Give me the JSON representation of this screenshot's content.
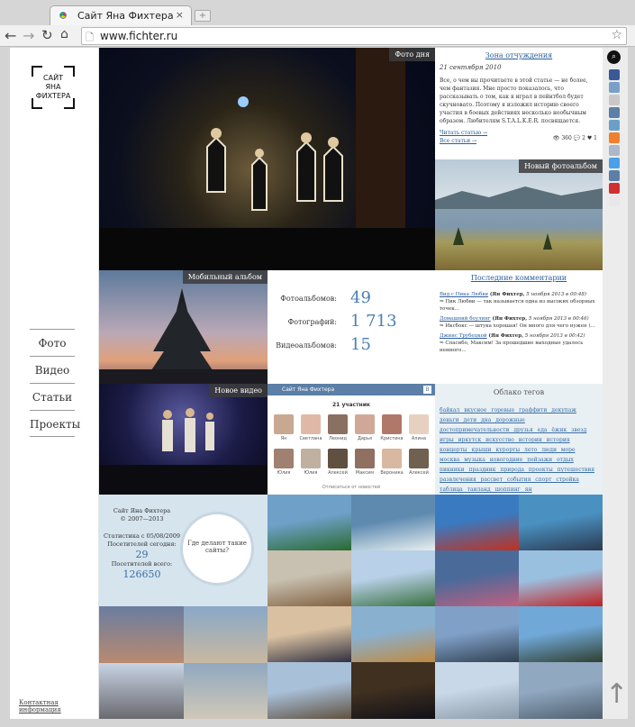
{
  "browser": {
    "tab_title": "Сайт Яна Фихтера",
    "tab_close": "×",
    "new_tab": "+",
    "url": "www.fichter.ru",
    "icons": [
      "back-icon",
      "forward-icon",
      "reload-icon",
      "home-icon",
      "page-icon",
      "star-icon"
    ]
  },
  "sidebar": {
    "logo": [
      "САЙТ",
      "ЯНА",
      "ФИХТЕРА"
    ],
    "menu": [
      "Фото",
      "Видео",
      "Статьи",
      "Проекты"
    ],
    "contact": "Контактная информация"
  },
  "photo_day": {
    "label": "Фото дня"
  },
  "article": {
    "title": "Зона отчуждения",
    "date": "21 сентября 2010",
    "text": "Все, о чем вы прочитаете в этой статье — не более, чем фантазия. Мне просто показалось, что рассказывать о том, как я играл в пейнтбол будет скучновато. Поэтому я изложил историю своего участия в боевых действиях несколько необычным образом. Любителям S.T.A.L.K.E.R. посвящается.",
    "read_more": "Читать статью →",
    "all_articles": "Все статьи →",
    "views": "360",
    "comments": "2",
    "likes": "1"
  },
  "new_album": {
    "label": "Новый фотоальбом"
  },
  "mobile_album": {
    "label": "Мобильный альбом"
  },
  "stats": [
    {
      "key": "Фотоальбомов:",
      "value": "49"
    },
    {
      "key": "Фотографий:",
      "value": "1 713"
    },
    {
      "key": "Видеоальбомов:",
      "value": "15"
    }
  ],
  "comments": {
    "title": "Последние комментарии",
    "items": [
      {
        "post": "Вид с Пика Любви",
        "author": "(Ян Фихтер,",
        "date": "5 ноября 2013 в 00:48)",
        "text": "⇒ Пик Любви — так называется одна из высоких обзорных точек..."
      },
      {
        "post": "Домашний боулинг",
        "author": "(Ян Фихтер,",
        "date": "5 ноября 2013 в 00:46)",
        "text": "⇒ Иксбокс — штука хорошая! Он много для чего нужен )..."
      },
      {
        "post": "Джинс Трубецкой",
        "author": "(Ян Фихтер,",
        "date": "5 ноября 2013 в 00:42)",
        "text": "⇒ Спасибо, Максим! За прошедшие выходные удалось немного..."
      }
    ]
  },
  "new_video": {
    "label": "Новое видео"
  },
  "vk": {
    "title": "Сайт Яна Фихтера",
    "members": "21 участник",
    "names": [
      "Ян",
      "Светлана",
      "Леонид",
      "Дарья",
      "Кристина",
      "Алина",
      "Юлия",
      "Юлия",
      "Алексей",
      "Максим",
      "Вероника",
      "Алексей"
    ],
    "unsubscribe": "Отписаться от новостей"
  },
  "tags": {
    "title": "Облако тегов",
    "text": "байкал вкусное горевые граффити декупаж деньги дети дна дорожные достопримечательности друзья еда ёжик звезд игры иркутск искусство истории история концерты крыши курорты лето люди море москва музыка новогодние пейзажи отдых пикники праздник природа проекты путешествия развлечения рассвет события спорт стройка таблица таиланд шоппинг ян"
  },
  "site_stats": {
    "title": "Сайт Яна Фихтера",
    "years": "© 2007—2013",
    "since": "Статистика с 05/08/2009",
    "today_label": "Посетителей сегодня:",
    "today": "29",
    "total_label": "Посетителей всего:",
    "total": "126650",
    "bubble": "Где делают такие сайты?"
  }
}
